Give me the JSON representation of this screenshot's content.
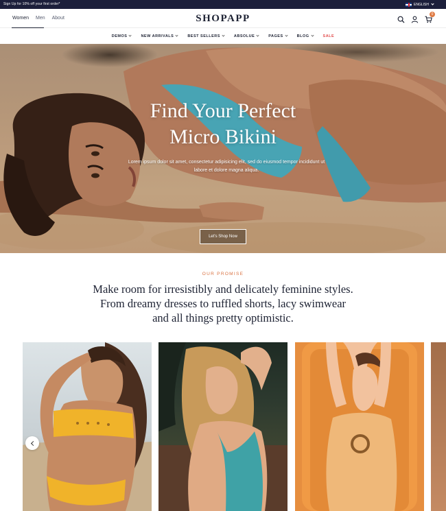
{
  "topbar": {
    "promo": "Sign Up for 10% off your first order*",
    "language": "ENGLISH"
  },
  "header": {
    "gender_tabs": [
      {
        "label": "Women",
        "active": true
      },
      {
        "label": "Men",
        "active": false
      },
      {
        "label": "About",
        "active": false
      }
    ],
    "logo": "SHOPAPP",
    "icons": [
      "search-icon",
      "user-icon",
      "cart-icon"
    ],
    "cart_count": "0"
  },
  "nav": {
    "items": [
      {
        "label": "DEMOS",
        "dropdown": true
      },
      {
        "label": "NEW ARRIVALS",
        "dropdown": true
      },
      {
        "label": "BEST SELLERS",
        "dropdown": true
      },
      {
        "label": "ABSOLUE",
        "dropdown": true
      },
      {
        "label": "PAGES",
        "dropdown": true
      },
      {
        "label": "BLOG",
        "dropdown": true
      },
      {
        "label": "SALE",
        "dropdown": false
      }
    ]
  },
  "hero": {
    "title_line1": "Find Your Perfect",
    "title_line2": "Micro Bikini",
    "subtitle": "Lorem ipsum dolor sit amet, consectetur adipisicing elit, sed do eiusmod tempor incididunt ut labore et dolore magna aliqua.",
    "button_label": "Let's Shop Now"
  },
  "promise": {
    "label": "OUR PROMISE",
    "line1": "Make room for irresistibly and delicately feminine styles.",
    "line2": "From dreamy dresses to ruffled shorts, lacy swimwear",
    "line3": "and all things pretty optimistic."
  },
  "carousel": {
    "cards": [
      {
        "name": "yellow-bandeau-bikini"
      },
      {
        "name": "teal-plunge-swimsuit"
      },
      {
        "name": "orange-ring-swimsuit"
      },
      {
        "name": "partial-next-product"
      }
    ],
    "colors": {
      "accent": "#e07a43",
      "navy": "#1c1f3b",
      "sale": "#e24c4c"
    }
  }
}
